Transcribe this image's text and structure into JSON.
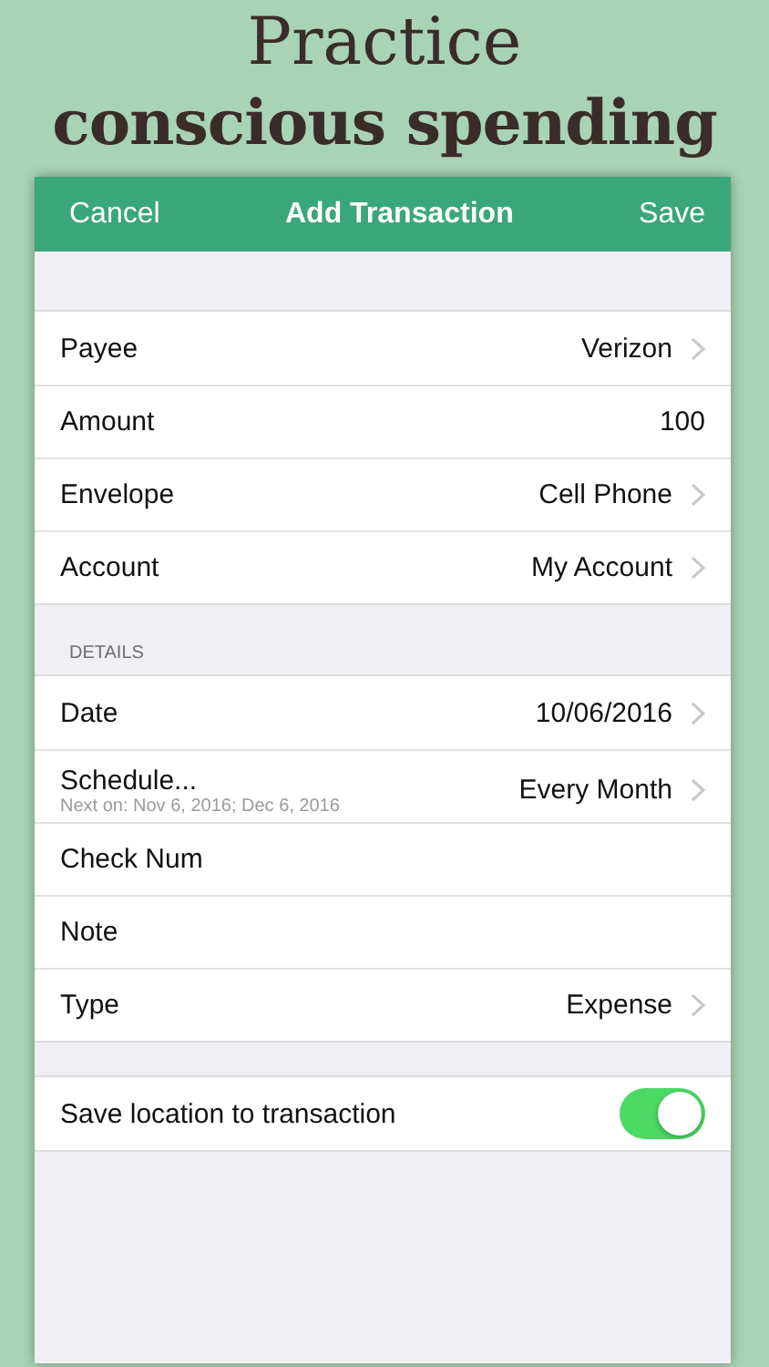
{
  "headline": {
    "line_1": "Practice",
    "line_2": "conscious spending"
  },
  "nav_bar": {
    "left_button": "Cancel",
    "title": "Add Transaction",
    "right_button": "Save"
  },
  "sections": [
    {
      "rows": [
        {
          "kind": "detail",
          "label": "Payee",
          "value": "Verizon",
          "chevron": true
        },
        {
          "kind": "detail",
          "label": "Amount",
          "value": "100",
          "chevron": false
        },
        {
          "kind": "detail",
          "label": "Envelope",
          "value": "Cell Phone",
          "chevron": true
        },
        {
          "kind": "detail",
          "label": "Account",
          "value": "My Account",
          "chevron": true
        }
      ]
    },
    {
      "header": "DETAILS",
      "rows": [
        {
          "kind": "detail",
          "label": "Date",
          "value": "10/06/2016",
          "chevron": true
        },
        {
          "kind": "detail",
          "label": "Schedule...",
          "subtitle": "Next on: Nov 6, 2016; Dec 6, 2016",
          "value": "Every Month",
          "chevron": true
        },
        {
          "kind": "detail",
          "label": "Check Num",
          "chevron": false
        },
        {
          "kind": "detail",
          "label": "Note",
          "chevron": false
        },
        {
          "kind": "detail",
          "label": "Type",
          "value": "Expense",
          "chevron": true
        }
      ]
    },
    {
      "rows": [
        {
          "kind": "toggle",
          "label": "Save location to transaction",
          "on": true
        }
      ]
    }
  ]
}
